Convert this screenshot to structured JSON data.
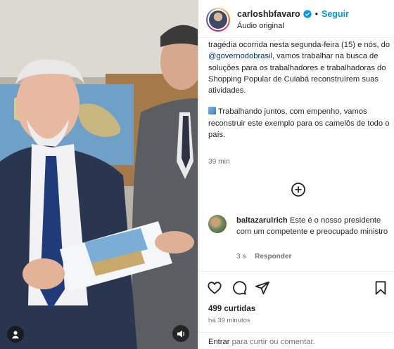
{
  "post": {
    "username": "carloshbfavaro",
    "separator": "•",
    "follow_label": "Seguir",
    "audio_label": "Áudio original"
  },
  "caption": {
    "line1": "tragédia ocorrida nesta segunda-feira (15) e nós, do ",
    "mention": "@governodobrasil",
    "line1b": ", vamos trabalhar na busca de soluções para os trabalhadores e trabalhadoras do Shopping Popular de Cuiabá reconstruírem suas atividades.",
    "paragraph2": "Trabalhando juntos, com empenho, vamos reconstruir este exemplo para os camelôs de todo o país.",
    "time": "39 min"
  },
  "comment": {
    "username": "baltazarulrich",
    "text": " Este é o nosso presidente com um competente e preocupado ministro",
    "time": "3 s",
    "reply_label": "Responder"
  },
  "stats": {
    "likes": "499 curtidas",
    "ago": "há 39 minutos"
  },
  "login": {
    "enter": "Entrar",
    "rest": " para curtir ou comentar."
  },
  "icons": {
    "more": "more-options-icon",
    "load_more": "plus-circle-icon",
    "like": "heart-icon",
    "comment": "comment-icon",
    "share": "share-icon",
    "save": "bookmark-icon",
    "user_tag": "user-icon",
    "sound": "speaker-icon"
  },
  "colors": {
    "link": "#0095f6",
    "mention": "#00376b",
    "secondary_text": "#737373"
  }
}
